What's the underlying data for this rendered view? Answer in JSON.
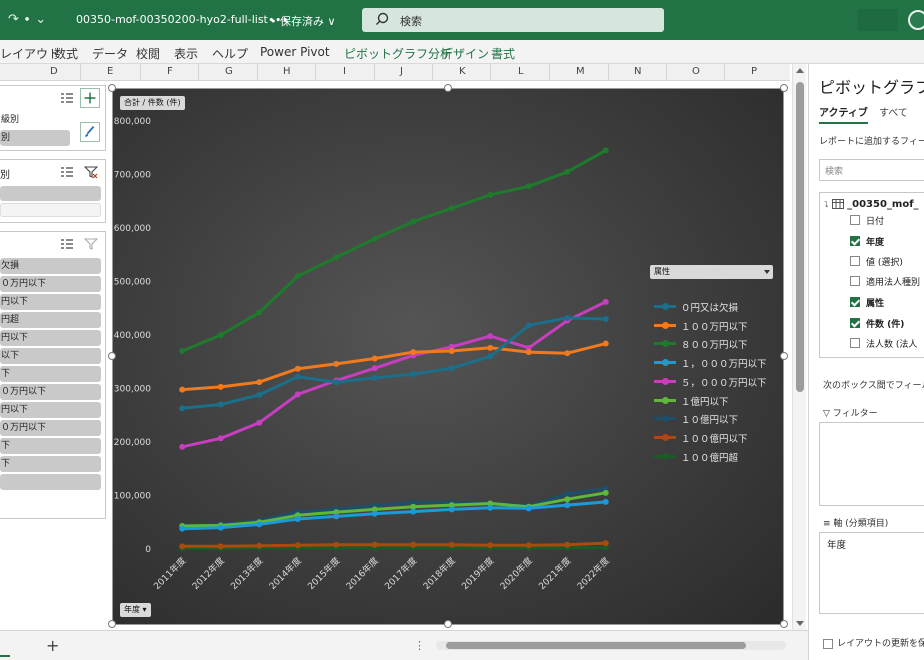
{
  "titlebar": {
    "quick_access": "↷ ∙ ⌄",
    "filename": "00350-mof-00350200-hyo2-full-list∙∙∙",
    "save_status": "• 保存済み ∨",
    "search_placeholder": "検索"
  },
  "ribbon": {
    "tabs": [
      "レイアウト",
      "数式",
      "データ",
      "校閲",
      "表示",
      "ヘルプ",
      "Power Pivot",
      "ピボットグラフ分析",
      "デザイン",
      "書式"
    ]
  },
  "columns": [
    "D",
    "E",
    "F",
    "G",
    "H",
    "I",
    "J",
    "K",
    "L",
    "M",
    "N",
    "O",
    "P"
  ],
  "slicers": {
    "s1": {
      "items": [
        "級別",
        "別"
      ]
    },
    "s2": {
      "title": "別"
    },
    "s3": {
      "items": [
        "欠損",
        "０万円以下",
        "円以下",
        "円超",
        "円以下",
        "以下",
        "下",
        "０万円以下",
        "円以下",
        "０万円以下",
        "下",
        "下"
      ]
    }
  },
  "chart": {
    "value_field_button": "合計 / 件数 (件)",
    "axis_field_button": "年度",
    "legend_field_button": "属性"
  },
  "chart_data": {
    "type": "line",
    "title": "",
    "xlabel": "",
    "ylabel": "",
    "ylim": [
      0,
      800000
    ],
    "yticks": [
      "0",
      "100,000",
      "200,000",
      "300,000",
      "400,000",
      "500,000",
      "600,000",
      "700,000",
      "800,000"
    ],
    "grid": false,
    "legend_position": "right",
    "categories": [
      "2011年度",
      "2012年度",
      "2013年度",
      "2014年度",
      "2015年度",
      "2016年度",
      "2017年度",
      "2018年度",
      "2019年度",
      "2020年度",
      "2021年度",
      "2022年度"
    ],
    "series": [
      {
        "name": "０円又は欠損",
        "color": "#1b6f8a",
        "values": [
          263000,
          270000,
          288000,
          322000,
          312000,
          320000,
          327000,
          338000,
          360000,
          418000,
          432000,
          430000
        ]
      },
      {
        "name": "１００万円以下",
        "color": "#f07a1d",
        "values": [
          298000,
          303000,
          312000,
          337000,
          346000,
          356000,
          368000,
          370000,
          376000,
          368000,
          366000,
          384000
        ]
      },
      {
        "name": "８００万円以下",
        "color": "#1e7a2c",
        "values": [
          370000,
          400000,
          442000,
          510000,
          545000,
          580000,
          612000,
          637000,
          662000,
          678000,
          705000,
          745000
        ]
      },
      {
        "name": "１，０００万円以下",
        "color": "#1a9bd8",
        "values": [
          38000,
          40000,
          46000,
          56000,
          61000,
          66000,
          70000,
          74000,
          77000,
          76000,
          82000,
          88000
        ]
      },
      {
        "name": "５，０００万円以下",
        "color": "#c73fc0",
        "values": [
          191000,
          207000,
          236000,
          289000,
          315000,
          338000,
          362000,
          378000,
          398000,
          376000,
          427000,
          462000
        ]
      },
      {
        "name": "１億円以下",
        "color": "#5fb83a",
        "values": [
          43000,
          44000,
          50000,
          63000,
          69000,
          74000,
          79000,
          82000,
          85000,
          79000,
          93000,
          105000
        ]
      },
      {
        "name": "１０億円以下",
        "color": "#1c4f6b",
        "values": [
          44000,
          46000,
          53000,
          69000,
          75000,
          81000,
          87000,
          87000,
          86000,
          80000,
          103000,
          113000
        ]
      },
      {
        "name": "１００億円以下",
        "color": "#a84b10",
        "values": [
          5000,
          5000,
          6000,
          7000,
          8000,
          8000,
          8000,
          8000,
          7000,
          7000,
          8000,
          11000
        ]
      },
      {
        "name": "１００億円超",
        "color": "#1a5c25",
        "values": [
          1500,
          1500,
          1800,
          2000,
          2100,
          2200,
          2300,
          2300,
          2300,
          2200,
          2300,
          2600
        ]
      }
    ]
  },
  "pane": {
    "title": "ピボットグラフの",
    "tab_active": "アクティブ",
    "tab_all": "すべて",
    "subtitle": "レポートに追加するフィールド",
    "search_placeholder": "検索",
    "table_name": "_00350_mof_",
    "fields": [
      {
        "label": "日付",
        "checked": false
      },
      {
        "label": "年度",
        "checked": true
      },
      {
        "label": "値 (選択)",
        "checked": false
      },
      {
        "label": "適用法人種別",
        "checked": false
      },
      {
        "label": "属性",
        "checked": true
      },
      {
        "label": "件数 (件)",
        "checked": true
      },
      {
        "label": "法人数 (法人",
        "checked": false
      }
    ],
    "hint": "次のボックス間でフィールドを",
    "filter_label": "フィルター",
    "axis_label": "軸 (分類項目)",
    "axis_item": "年度",
    "footer": "レイアウトの更新を保"
  }
}
